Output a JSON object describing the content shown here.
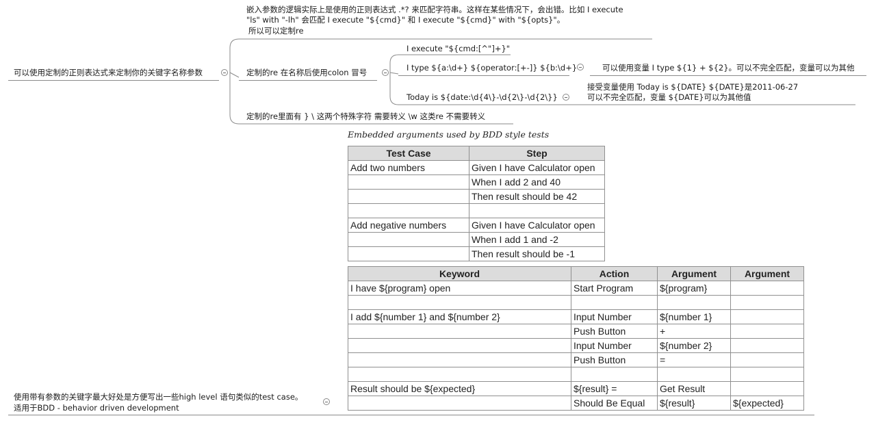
{
  "root": {
    "label": "可以使用定制的正则表达式来定制你的关键字名称参数"
  },
  "branch1": {
    "line1": "嵌入参数的逻辑实际上是使用的正则表达式  .*?  来匹配字符串。这样在某些情况下，会出错。比如 I execute",
    "line2": "\"ls\" with \"-lh\"  会匹配 I execute \"${cmd}\"  和 I execute \"${cmd}\" with \"${opts}\"。",
    "line3": "所以可以定制re"
  },
  "branch2": {
    "label": "定制的re 在名称后使用colon 冒号",
    "children": {
      "execute": "I execute \"${cmd:[^\"]+}\"",
      "type_label": "I type ${a:\\d+} ${operator:[+-]} ${b:\\d+}",
      "type_note": "可以使用变量 I type ${1} + ${2}。可以不完全匹配，变量可以为其他",
      "today_label": "Today is ${date:\\d{4\\}-\\d{2\\}-\\d{2\\}}",
      "today_note_line1": "接受变量使用        Today is ${DATE}        ${DATE}是2011-06-27",
      "today_note_line2": "可以不完全匹配，变量 ${DATE}可以为其他值"
    }
  },
  "branch3": {
    "label": "定制的re里面有 } \\   这两个特殊字符 需要转义   \\w 这类re 不需要转义"
  },
  "bdd": {
    "line1": "使用带有参数的关键字最大好处是方便写出一些high level 语句类似的test case。",
    "line2": "适用于BDD - behavior driven development",
    "title": "Embedded arguments used by BDD style tests",
    "testcase_table": {
      "headers": [
        "Test Case",
        "Step"
      ],
      "rows": [
        [
          "Add two numbers",
          "Given I have Calculator open"
        ],
        [
          "",
          "When I add 2 and 40"
        ],
        [
          "",
          "Then result should be 42"
        ],
        [
          "",
          ""
        ],
        [
          "Add negative numbers",
          "Given I have Calculator open"
        ],
        [
          "",
          "When I add 1 and -2"
        ],
        [
          "",
          "Then result should be -1"
        ]
      ]
    },
    "keyword_table": {
      "headers": [
        "Keyword",
        "Action",
        "Argument",
        "Argument"
      ],
      "rows": [
        [
          "I have ${program} open",
          "Start Program",
          "${program}",
          ""
        ],
        [
          "",
          "",
          "",
          ""
        ],
        [
          "I add ${number 1} and ${number 2}",
          "Input Number",
          "${number 1}",
          ""
        ],
        [
          "",
          "Push Button",
          "+",
          ""
        ],
        [
          "",
          "Input Number",
          "${number 2}",
          ""
        ],
        [
          "",
          "Push Button",
          "=",
          ""
        ],
        [
          "",
          "",
          "",
          ""
        ],
        [
          "Result should be ${expected}",
          "${result} =",
          "Get Result",
          ""
        ],
        [
          "",
          "Should Be Equal",
          "${result}",
          "${expected}"
        ]
      ]
    }
  }
}
